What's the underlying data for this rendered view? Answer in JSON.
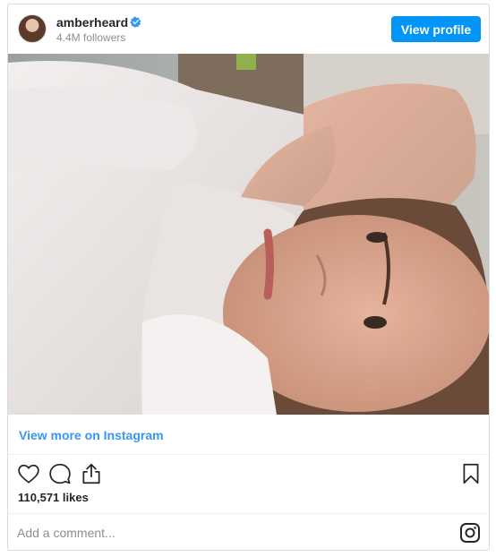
{
  "header": {
    "username": "amberheard",
    "followers": "4.4M followers",
    "view_profile_label": "View profile"
  },
  "icons": {
    "verified": "verified-badge-icon",
    "like": "heart-icon",
    "comment": "comment-icon",
    "share": "share-icon",
    "save": "bookmark-icon",
    "instagram": "instagram-icon"
  },
  "post": {
    "view_more_label": "View more on Instagram",
    "likes": "110,571 likes"
  },
  "comment": {
    "placeholder": "Add a comment..."
  },
  "colors": {
    "accent": "#0095f6",
    "link": "#3897f0",
    "muted": "#8e8e8e",
    "border": "#dbdbdb"
  }
}
